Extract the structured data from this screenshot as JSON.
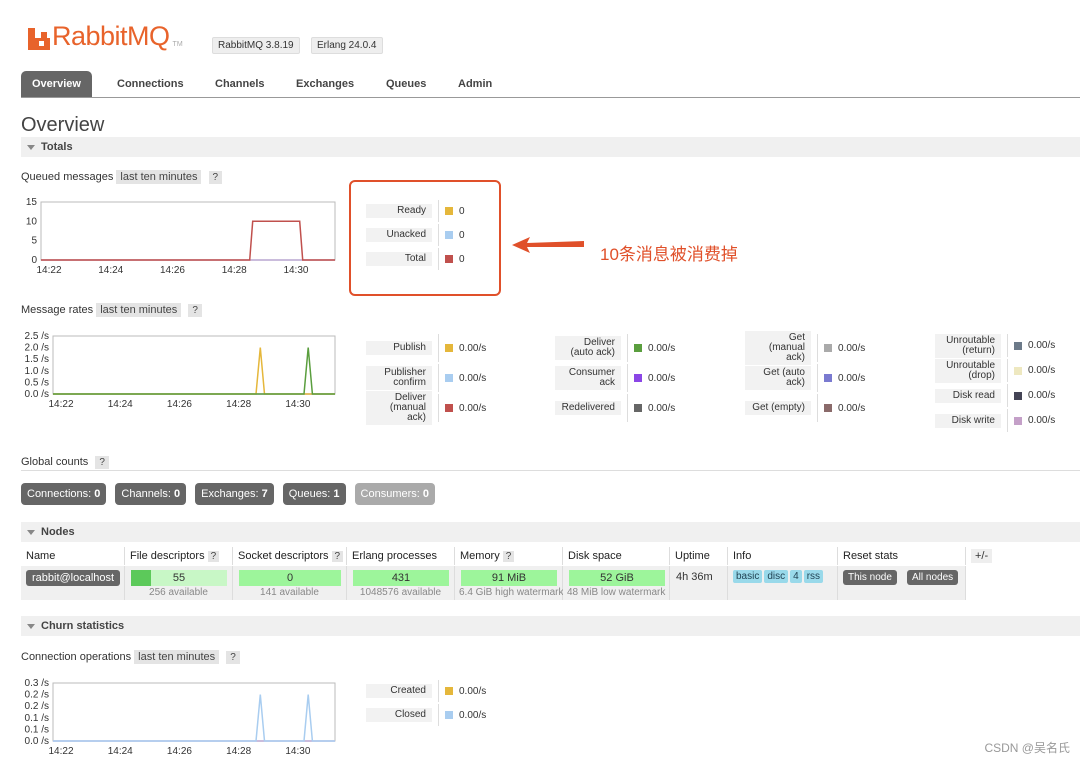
{
  "header": {
    "brand": "RabbitMQ",
    "tm": "TM",
    "rabbitmq_version": "RabbitMQ 3.8.19",
    "erlang_version": "Erlang 24.0.4"
  },
  "tabs": [
    "Overview",
    "Connections",
    "Channels",
    "Exchanges",
    "Queues",
    "Admin"
  ],
  "page_title": "Overview",
  "sections": {
    "totals": "Totals",
    "nodes": "Nodes",
    "churn": "Churn statistics"
  },
  "queued": {
    "label": "Queued messages",
    "range": "last ten minutes",
    "help": "?",
    "chart_data": {
      "type": "line",
      "x": [
        "14:22",
        "14:24",
        "14:26",
        "14:28",
        "14:30"
      ],
      "yticks": [
        "15",
        "10",
        "5",
        "0"
      ],
      "ylim": [
        0,
        15
      ],
      "series": [
        {
          "name": "Total",
          "color": "#c0504d",
          "points": [
            [
              0,
              0
            ],
            [
              0.71,
              0
            ],
            [
              0.72,
              10
            ],
            [
              0.88,
              10
            ],
            [
              0.89,
              0
            ],
            [
              1,
              0
            ]
          ]
        }
      ]
    },
    "legend": [
      {
        "label": "Ready",
        "value": "0",
        "color": "#e5b73b"
      },
      {
        "label": "Unacked",
        "value": "0",
        "color": "#a9cdf0"
      },
      {
        "label": "Total",
        "value": "0",
        "color": "#c0504d"
      }
    ]
  },
  "annotation": "10条消息被消费掉",
  "rates": {
    "label": "Message rates",
    "range": "last ten minutes",
    "help": "?",
    "chart_data": {
      "type": "line",
      "x": [
        "14:22",
        "14:24",
        "14:26",
        "14:28",
        "14:30"
      ],
      "yticks": [
        "2.5 /s",
        "2.0 /s",
        "1.5 /s",
        "1.0 /s",
        "0.5 /s",
        "0.0 /s"
      ],
      "ylim": [
        0,
        2.5
      ],
      "series": [
        {
          "name": "Publish",
          "color": "#e5b73b",
          "points": [
            [
              0,
              0
            ],
            [
              0.72,
              0
            ],
            [
              0.735,
              2.0
            ],
            [
              0.75,
              0
            ],
            [
              1,
              0
            ]
          ]
        },
        {
          "name": "Deliver (auto ack)",
          "color": "#5a9e3e",
          "points": [
            [
              0,
              0
            ],
            [
              0.89,
              0
            ],
            [
              0.905,
              2.0
            ],
            [
              0.92,
              0
            ],
            [
              1,
              0
            ]
          ]
        }
      ]
    },
    "col1": [
      {
        "label": "Publish",
        "value": "0.00/s",
        "color": "#e5b73b"
      },
      {
        "label": "Publisher confirm",
        "value": "0.00/s",
        "color": "#a9cdf0"
      },
      {
        "label": "Deliver (manual ack)",
        "value": "0.00/s",
        "color": "#c0504d"
      }
    ],
    "col2": [
      {
        "label": "Deliver (auto ack)",
        "value": "0.00/s",
        "color": "#5a9e3e"
      },
      {
        "label": "Consumer ack",
        "value": "0.00/s",
        "color": "#8b46e6"
      },
      {
        "label": "Redelivered",
        "value": "0.00/s",
        "color": "#666666"
      }
    ],
    "col3": [
      {
        "label": "Get (manual ack)",
        "value": "0.00/s",
        "color": "#aaaaaa"
      },
      {
        "label": "Get (auto ack)",
        "value": "0.00/s",
        "color": "#7a7ad0"
      },
      {
        "label": "Get (empty)",
        "value": "0.00/s",
        "color": "#8a6a6a"
      }
    ],
    "col4": [
      {
        "label": "Unroutable (return)",
        "value": "0.00/s",
        "color": "#6c7a89"
      },
      {
        "label": "Unroutable (drop)",
        "value": "0.00/s",
        "color": "#eee8c0"
      },
      {
        "label": "Disk read",
        "value": "0.00/s",
        "color": "#444455"
      },
      {
        "label": "Disk write",
        "value": "0.00/s",
        "color": "#c4a0c8"
      }
    ]
  },
  "global": {
    "label": "Global counts",
    "help": "?",
    "counts": [
      {
        "label": "Connections:",
        "value": "0"
      },
      {
        "label": "Channels:",
        "value": "0"
      },
      {
        "label": "Exchanges:",
        "value": "7"
      },
      {
        "label": "Queues:",
        "value": "1"
      },
      {
        "label": "Consumers:",
        "value": "0"
      }
    ]
  },
  "nodes": {
    "headers": [
      "Name",
      "File descriptors",
      "Socket descriptors",
      "Erlang processes",
      "Memory",
      "Disk space",
      "Uptime",
      "Info",
      "Reset stats"
    ],
    "plusminus": "+/-",
    "row": {
      "name": "rabbit@localhost",
      "fd": "55",
      "fd_sub": "256 available",
      "fd_frac": 0.21,
      "sd": "0",
      "sd_sub": "141 available",
      "ep": "431",
      "ep_sub": "1048576 available",
      "mem": "91 MiB",
      "mem_sub": "6.4 GiB high watermark",
      "disk": "52 GiB",
      "disk_sub": "48 MiB low watermark",
      "uptime": "4h 36m",
      "info_tags": [
        "basic",
        "disc",
        "4",
        "rss"
      ],
      "reset_this": "This node",
      "reset_all": "All nodes"
    }
  },
  "churn": {
    "label": "Connection operations",
    "range": "last ten minutes",
    "help": "?",
    "chart_data": {
      "type": "line",
      "x": [
        "14:22",
        "14:24",
        "14:26",
        "14:28",
        "14:30"
      ],
      "yticks": [
        "0.3 /s",
        "0.2 /s",
        "0.2 /s",
        "0.1 /s",
        "0.1 /s",
        "0.0 /s"
      ],
      "ylim": [
        0,
        0.25
      ],
      "series": [
        {
          "name": "Closed",
          "color": "#a9cdf0",
          "points": [
            [
              0,
              0
            ],
            [
              0.72,
              0
            ],
            [
              0.735,
              0.2
            ],
            [
              0.75,
              0
            ],
            [
              0.89,
              0
            ],
            [
              0.905,
              0.2
            ],
            [
              0.92,
              0
            ],
            [
              1,
              0
            ]
          ]
        }
      ]
    },
    "legend": [
      {
        "label": "Created",
        "value": "0.00/s",
        "color": "#e5b73b"
      },
      {
        "label": "Closed",
        "value": "0.00/s",
        "color": "#a9cdf0"
      }
    ]
  },
  "watermark": "CSDN @吴名氏"
}
